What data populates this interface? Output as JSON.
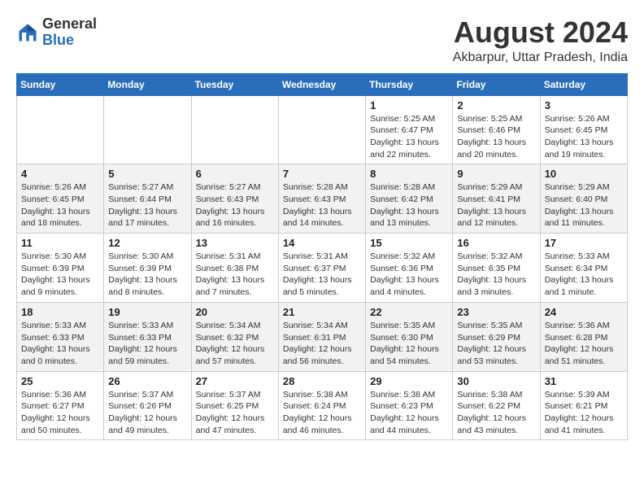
{
  "logo": {
    "general": "General",
    "blue": "Blue"
  },
  "title": "August 2024",
  "location": "Akbarpur, Uttar Pradesh, India",
  "weekdays": [
    "Sunday",
    "Monday",
    "Tuesday",
    "Wednesday",
    "Thursday",
    "Friday",
    "Saturday"
  ],
  "weeks": [
    [
      {
        "day": "",
        "info": ""
      },
      {
        "day": "",
        "info": ""
      },
      {
        "day": "",
        "info": ""
      },
      {
        "day": "",
        "info": ""
      },
      {
        "day": "1",
        "info": "Sunrise: 5:25 AM\nSunset: 6:47 PM\nDaylight: 13 hours\nand 22 minutes."
      },
      {
        "day": "2",
        "info": "Sunrise: 5:25 AM\nSunset: 6:46 PM\nDaylight: 13 hours\nand 20 minutes."
      },
      {
        "day": "3",
        "info": "Sunrise: 5:26 AM\nSunset: 6:45 PM\nDaylight: 13 hours\nand 19 minutes."
      }
    ],
    [
      {
        "day": "4",
        "info": "Sunrise: 5:26 AM\nSunset: 6:45 PM\nDaylight: 13 hours\nand 18 minutes."
      },
      {
        "day": "5",
        "info": "Sunrise: 5:27 AM\nSunset: 6:44 PM\nDaylight: 13 hours\nand 17 minutes."
      },
      {
        "day": "6",
        "info": "Sunrise: 5:27 AM\nSunset: 6:43 PM\nDaylight: 13 hours\nand 16 minutes."
      },
      {
        "day": "7",
        "info": "Sunrise: 5:28 AM\nSunset: 6:43 PM\nDaylight: 13 hours\nand 14 minutes."
      },
      {
        "day": "8",
        "info": "Sunrise: 5:28 AM\nSunset: 6:42 PM\nDaylight: 13 hours\nand 13 minutes."
      },
      {
        "day": "9",
        "info": "Sunrise: 5:29 AM\nSunset: 6:41 PM\nDaylight: 13 hours\nand 12 minutes."
      },
      {
        "day": "10",
        "info": "Sunrise: 5:29 AM\nSunset: 6:40 PM\nDaylight: 13 hours\nand 11 minutes."
      }
    ],
    [
      {
        "day": "11",
        "info": "Sunrise: 5:30 AM\nSunset: 6:39 PM\nDaylight: 13 hours\nand 9 minutes."
      },
      {
        "day": "12",
        "info": "Sunrise: 5:30 AM\nSunset: 6:39 PM\nDaylight: 13 hours\nand 8 minutes."
      },
      {
        "day": "13",
        "info": "Sunrise: 5:31 AM\nSunset: 6:38 PM\nDaylight: 13 hours\nand 7 minutes."
      },
      {
        "day": "14",
        "info": "Sunrise: 5:31 AM\nSunset: 6:37 PM\nDaylight: 13 hours\nand 5 minutes."
      },
      {
        "day": "15",
        "info": "Sunrise: 5:32 AM\nSunset: 6:36 PM\nDaylight: 13 hours\nand 4 minutes."
      },
      {
        "day": "16",
        "info": "Sunrise: 5:32 AM\nSunset: 6:35 PM\nDaylight: 13 hours\nand 3 minutes."
      },
      {
        "day": "17",
        "info": "Sunrise: 5:33 AM\nSunset: 6:34 PM\nDaylight: 13 hours\nand 1 minute."
      }
    ],
    [
      {
        "day": "18",
        "info": "Sunrise: 5:33 AM\nSunset: 6:33 PM\nDaylight: 13 hours\nand 0 minutes."
      },
      {
        "day": "19",
        "info": "Sunrise: 5:33 AM\nSunset: 6:33 PM\nDaylight: 12 hours\nand 59 minutes."
      },
      {
        "day": "20",
        "info": "Sunrise: 5:34 AM\nSunset: 6:32 PM\nDaylight: 12 hours\nand 57 minutes."
      },
      {
        "day": "21",
        "info": "Sunrise: 5:34 AM\nSunset: 6:31 PM\nDaylight: 12 hours\nand 56 minutes."
      },
      {
        "day": "22",
        "info": "Sunrise: 5:35 AM\nSunset: 6:30 PM\nDaylight: 12 hours\nand 54 minutes."
      },
      {
        "day": "23",
        "info": "Sunrise: 5:35 AM\nSunset: 6:29 PM\nDaylight: 12 hours\nand 53 minutes."
      },
      {
        "day": "24",
        "info": "Sunrise: 5:36 AM\nSunset: 6:28 PM\nDaylight: 12 hours\nand 51 minutes."
      }
    ],
    [
      {
        "day": "25",
        "info": "Sunrise: 5:36 AM\nSunset: 6:27 PM\nDaylight: 12 hours\nand 50 minutes."
      },
      {
        "day": "26",
        "info": "Sunrise: 5:37 AM\nSunset: 6:26 PM\nDaylight: 12 hours\nand 49 minutes."
      },
      {
        "day": "27",
        "info": "Sunrise: 5:37 AM\nSunset: 6:25 PM\nDaylight: 12 hours\nand 47 minutes."
      },
      {
        "day": "28",
        "info": "Sunrise: 5:38 AM\nSunset: 6:24 PM\nDaylight: 12 hours\nand 46 minutes."
      },
      {
        "day": "29",
        "info": "Sunrise: 5:38 AM\nSunset: 6:23 PM\nDaylight: 12 hours\nand 44 minutes."
      },
      {
        "day": "30",
        "info": "Sunrise: 5:38 AM\nSunset: 6:22 PM\nDaylight: 12 hours\nand 43 minutes."
      },
      {
        "day": "31",
        "info": "Sunrise: 5:39 AM\nSunset: 6:21 PM\nDaylight: 12 hours\nand 41 minutes."
      }
    ]
  ]
}
